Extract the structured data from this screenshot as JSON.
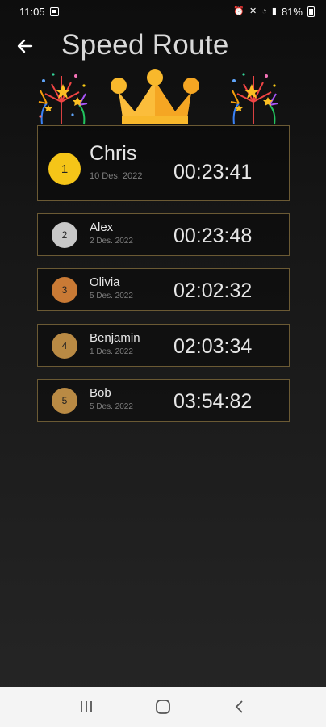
{
  "status_bar": {
    "time": "11:05",
    "battery": "81%"
  },
  "header": {
    "title": "Speed Route"
  },
  "colors": {
    "gold": "#f5c518",
    "silver": "#c8c8c8",
    "bronze": "#c97a35",
    "bronze_dark": "#b98a44",
    "card_border": "#6b5a34",
    "crown": "#fbbd3b"
  },
  "leaderboard": [
    {
      "rank": "1",
      "name": "Chris",
      "date": "10 Des. 2022",
      "time": "00:23:41"
    },
    {
      "rank": "2",
      "name": "Alex",
      "date": "2 Des. 2022",
      "time": "00:23:48"
    },
    {
      "rank": "3",
      "name": "Olivia",
      "date": "5 Des. 2022",
      "time": "02:02:32"
    },
    {
      "rank": "4",
      "name": "Benjamin",
      "date": "1 Des. 2022",
      "time": "02:03:34"
    },
    {
      "rank": "5",
      "name": "Bob",
      "date": "5 Des. 2022",
      "time": "03:54:82"
    }
  ],
  "icons": {
    "back": "arrow-left-icon",
    "crown": "crown-icon",
    "fireworks": "fireworks-icon",
    "nav_recents": "recents-icon",
    "nav_home": "home-icon",
    "nav_back": "back-chevron-icon"
  }
}
